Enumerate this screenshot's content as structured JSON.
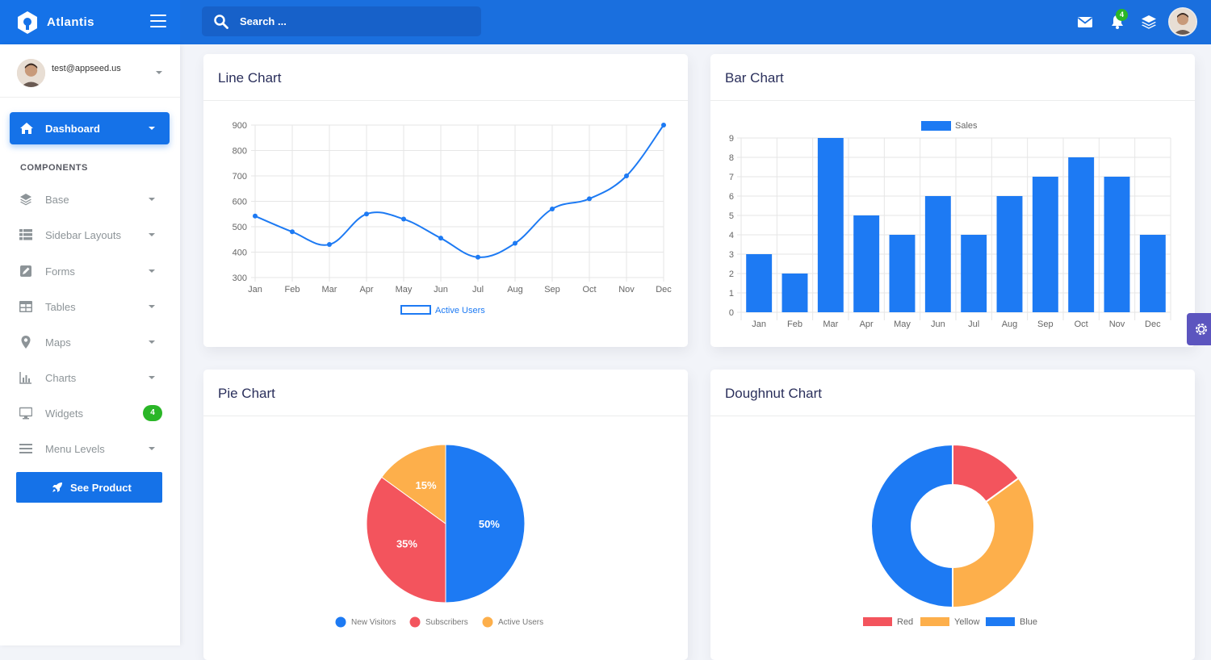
{
  "brand": {
    "name": "Atlantis"
  },
  "search": {
    "placeholder": "Search ..."
  },
  "header": {
    "notification_count": "4"
  },
  "user": {
    "email": "test@appseed.us"
  },
  "sidebar": {
    "dashboard_label": "Dashboard",
    "section_label": "COMPONENTS",
    "items": [
      {
        "label": "Base",
        "icon": "layers-icon"
      },
      {
        "label": "Sidebar Layouts",
        "icon": "th-list-icon"
      },
      {
        "label": "Forms",
        "icon": "pen-square-icon"
      },
      {
        "label": "Tables",
        "icon": "table-icon"
      },
      {
        "label": "Maps",
        "icon": "map-marker-icon"
      },
      {
        "label": "Charts",
        "icon": "bar-chart-icon"
      },
      {
        "label": "Widgets",
        "icon": "desktop-icon",
        "badge": "4"
      },
      {
        "label": "Menu Levels",
        "icon": "bars-icon"
      }
    ],
    "see_product_label": "See Product"
  },
  "cards": {
    "line_title": "Line Chart",
    "bar_title": "Bar Chart",
    "pie_title": "Pie Chart",
    "doughnut_title": "Doughnut Chart"
  },
  "colors": {
    "primary": "#1572e8",
    "blue": "#1d7af3",
    "red": "#f3545d",
    "yellow": "#fdaf4b",
    "green": "#2ab627"
  },
  "chart_data": [
    {
      "type": "line",
      "title": "",
      "categories": [
        "Jan",
        "Feb",
        "Mar",
        "Apr",
        "May",
        "Jun",
        "Jul",
        "Aug",
        "Sep",
        "Oct",
        "Nov",
        "Dec"
      ],
      "series": [
        {
          "name": "Active Users",
          "values": [
            542,
            480,
            430,
            550,
            530,
            455,
            380,
            435,
            570,
            610,
            700,
            900
          ]
        }
      ],
      "ylim": [
        300,
        900
      ],
      "yticks": [
        300,
        400,
        500,
        600,
        700,
        800,
        900
      ],
      "grid": true,
      "legend": "bottom"
    },
    {
      "type": "bar",
      "title": "",
      "categories": [
        "Jan",
        "Feb",
        "Mar",
        "Apr",
        "May",
        "Jun",
        "Jul",
        "Aug",
        "Sep",
        "Oct",
        "Nov",
        "Dec"
      ],
      "series": [
        {
          "name": "Sales",
          "values": [
            3,
            2,
            9,
            5,
            4,
            6,
            4,
            6,
            7,
            8,
            7,
            4
          ]
        }
      ],
      "ylim": [
        0,
        9
      ],
      "yticks": [
        0,
        1,
        2,
        3,
        4,
        5,
        6,
        7,
        8,
        9
      ],
      "grid": true,
      "legend": "top"
    },
    {
      "type": "pie",
      "title": "",
      "labels": [
        "New Visitors",
        "Subscribers",
        "Active Users"
      ],
      "values": [
        50,
        35,
        15
      ],
      "value_labels": [
        "50%",
        "35%",
        "15%"
      ],
      "legend": "bottom"
    },
    {
      "type": "pie",
      "subtype": "doughnut",
      "title": "",
      "labels": [
        "Red",
        "Yellow",
        "Blue"
      ],
      "values": [
        15,
        35,
        50
      ],
      "legend": "bottom"
    }
  ]
}
